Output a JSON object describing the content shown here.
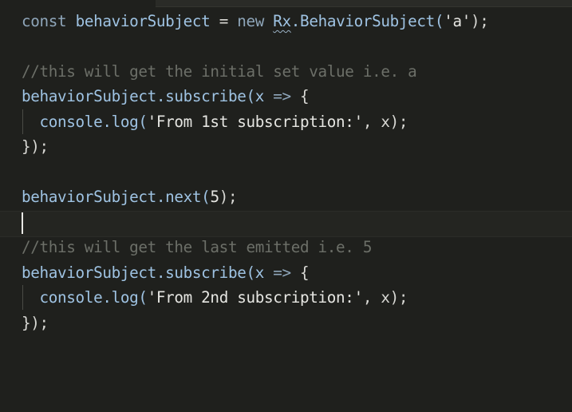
{
  "editor": {
    "lines": [
      {
        "tokens": [
          {
            "text": "const ",
            "kind": "keyword"
          },
          {
            "text": "behaviorSubject",
            "kind": "identifier"
          },
          {
            "text": " = ",
            "kind": "plain"
          },
          {
            "text": "new ",
            "kind": "keyword"
          },
          {
            "text": "Rx",
            "kind": "identifier-underlined"
          },
          {
            "text": ".BehaviorSubject(",
            "kind": "identifier"
          },
          {
            "text": "'a'",
            "kind": "string"
          },
          {
            "text": ");",
            "kind": "plain"
          }
        ]
      },
      {
        "tokens": []
      },
      {
        "tokens": [
          {
            "text": "//this will get the initial set value i.e. a",
            "kind": "comment"
          }
        ]
      },
      {
        "tokens": [
          {
            "text": "behaviorSubject",
            "kind": "identifier"
          },
          {
            "text": ".subscribe(",
            "kind": "identifier"
          },
          {
            "text": "x",
            "kind": "identifier"
          },
          {
            "text": " => ",
            "kind": "arrow"
          },
          {
            "text": "{",
            "kind": "plain"
          }
        ]
      },
      {
        "tokens": [
          {
            "text": "  console",
            "kind": "identifier"
          },
          {
            "text": ".log(",
            "kind": "identifier"
          },
          {
            "text": "'From 1st subscription:'",
            "kind": "string"
          },
          {
            "text": ", x);",
            "kind": "plain"
          }
        ]
      },
      {
        "tokens": [
          {
            "text": "});",
            "kind": "plain"
          }
        ]
      },
      {
        "tokens": []
      },
      {
        "tokens": [
          {
            "text": "behaviorSubject",
            "kind": "identifier"
          },
          {
            "text": ".next(",
            "kind": "identifier"
          },
          {
            "text": "5",
            "kind": "number"
          },
          {
            "text": ");",
            "kind": "plain"
          }
        ]
      },
      {
        "tokens": []
      },
      {
        "tokens": [
          {
            "text": "//this will get the last emitted i.e. 5",
            "kind": "comment"
          }
        ]
      },
      {
        "tokens": [
          {
            "text": "behaviorSubject",
            "kind": "identifier"
          },
          {
            "text": ".subscribe(",
            "kind": "identifier"
          },
          {
            "text": "x",
            "kind": "identifier"
          },
          {
            "text": " => ",
            "kind": "arrow"
          },
          {
            "text": "{",
            "kind": "plain"
          }
        ]
      },
      {
        "tokens": [
          {
            "text": "  console",
            "kind": "identifier"
          },
          {
            "text": ".log(",
            "kind": "identifier"
          },
          {
            "text": "'From 2nd subscription:'",
            "kind": "string"
          },
          {
            "text": ", x);",
            "kind": "plain"
          }
        ]
      },
      {
        "tokens": [
          {
            "text": "});",
            "kind": "plain"
          }
        ]
      }
    ]
  },
  "theme": {
    "background": "#1f201d",
    "keyword": "#8fa6ba",
    "identifier": "#9fc3e3",
    "string": "#e6e6e2",
    "comment": "#6c6f68",
    "cursor": "#e8e8e4"
  }
}
